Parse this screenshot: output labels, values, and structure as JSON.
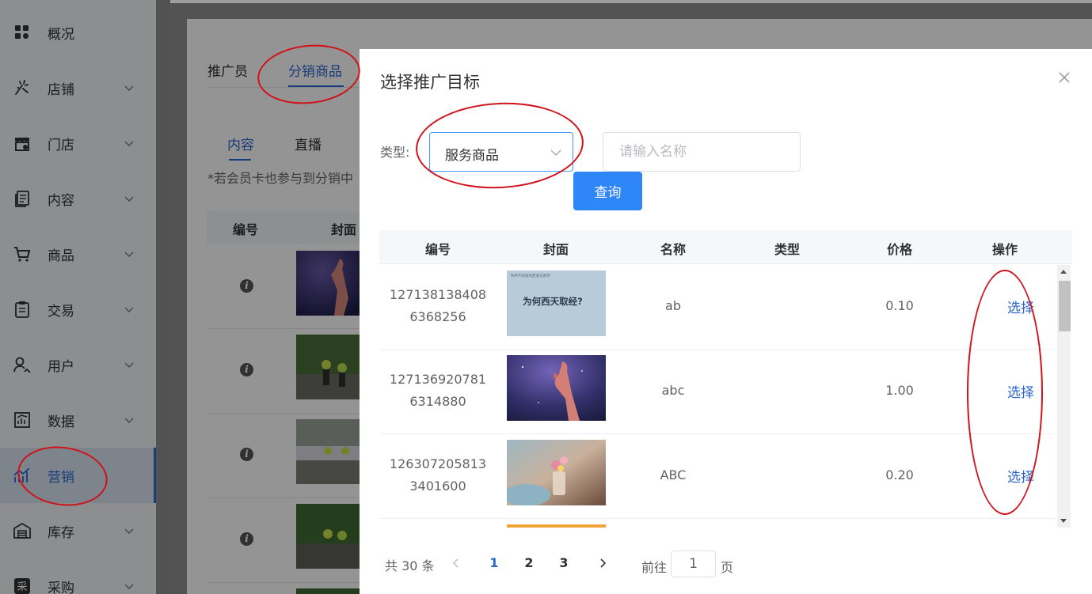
{
  "sidebar": {
    "items": [
      {
        "label": "概况",
        "icon": "grid-icon",
        "has_arrow": false,
        "active": false
      },
      {
        "label": "店铺",
        "icon": "shop-sparkle-icon",
        "has_arrow": true,
        "active": false
      },
      {
        "label": "门店",
        "icon": "store-icon",
        "has_arrow": true,
        "active": false
      },
      {
        "label": "内容",
        "icon": "document-icon",
        "has_arrow": true,
        "active": false
      },
      {
        "label": "商品",
        "icon": "cart-icon",
        "has_arrow": true,
        "active": false
      },
      {
        "label": "交易",
        "icon": "clipboard-icon",
        "has_arrow": true,
        "active": false
      },
      {
        "label": "用户",
        "icon": "users-icon",
        "has_arrow": true,
        "active": false
      },
      {
        "label": "数据",
        "icon": "chart-icon",
        "has_arrow": true,
        "active": false
      },
      {
        "label": "营销",
        "icon": "marketing-icon",
        "has_arrow": false,
        "active": true
      },
      {
        "label": "库存",
        "icon": "warehouse-icon",
        "has_arrow": true,
        "active": false
      },
      {
        "label": "采购",
        "icon": "purchase-icon",
        "has_arrow": true,
        "active": false
      }
    ],
    "purchase_glyph": "采"
  },
  "background": {
    "tabs": [
      "推广员",
      "分销商品"
    ],
    "subtabs": [
      "内容",
      "直播"
    ],
    "note": "*若会员卡也参与到分销中",
    "headers": [
      "编号",
      "封面"
    ]
  },
  "modal": {
    "title": "选择推广目标",
    "type_label": "类型:",
    "type_value": "服务商品",
    "name_placeholder": "请输入名称",
    "query_button": "查询",
    "columns": [
      "编号",
      "封面",
      "名称",
      "类型",
      "价格",
      "操作"
    ],
    "rows": [
      {
        "id_line1": "127138138408",
        "id_line2": "6368256",
        "name": "ab",
        "type": "",
        "price": "0.10",
        "action": "选择",
        "cover_text": "为何西天取经?",
        "cover_small": "你所不知道的西游记系列"
      },
      {
        "id_line1": "127136920781",
        "id_line2": "6314880",
        "name": "abc",
        "type": "",
        "price": "1.00",
        "action": "选择"
      },
      {
        "id_line1": "126307205813",
        "id_line2": "3401600",
        "name": "ABC",
        "type": "",
        "price": "0.20",
        "action": "选择"
      }
    ],
    "pagination": {
      "total": "共 30 条",
      "pages": [
        "1",
        "2",
        "3"
      ],
      "current": "1",
      "goto_prefix": "前往",
      "goto_value": "1",
      "goto_suffix": "页"
    }
  },
  "colors": {
    "accent": "#2b66d0",
    "query_button": "#2f86f6",
    "annotation": "#d0121b"
  }
}
